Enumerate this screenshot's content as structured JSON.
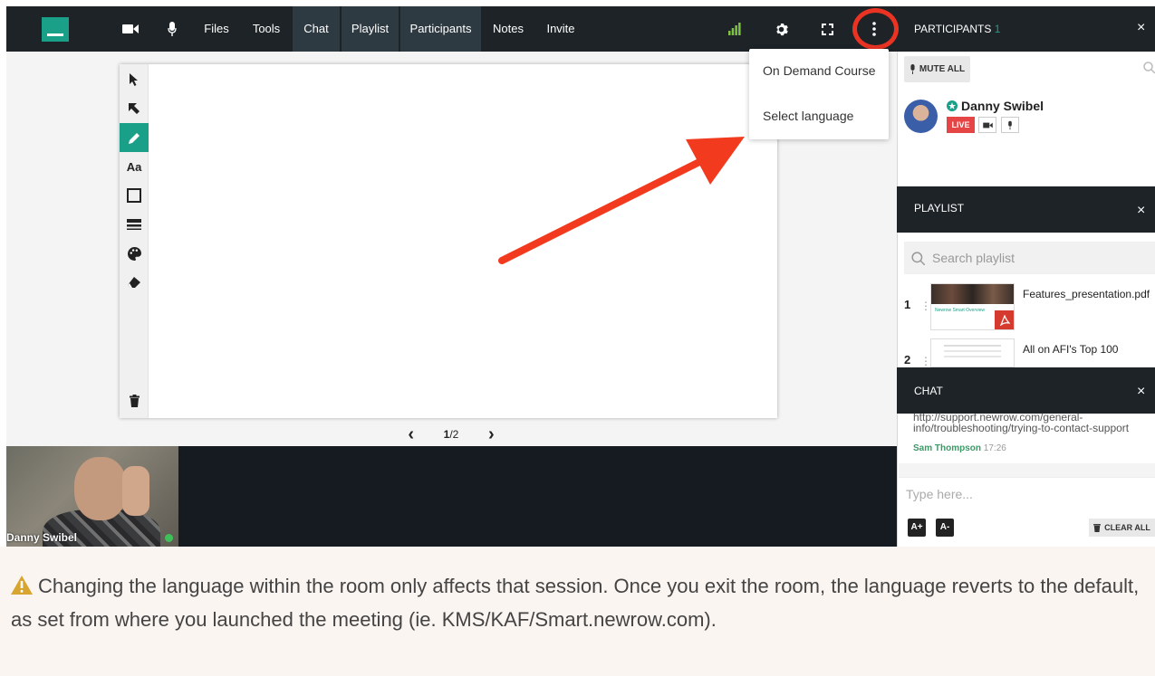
{
  "topbar": {
    "items": [
      "Files",
      "Tools",
      "Chat",
      "Playlist",
      "Participants",
      "Notes",
      "Invite"
    ],
    "icons": [
      "video-camera-icon",
      "microphone-icon",
      "signal-icon",
      "gear-icon",
      "fullscreen-icon",
      "more-vertical-icon"
    ]
  },
  "dropdown": {
    "items": [
      "On Demand Course",
      "Select language"
    ]
  },
  "whiteboard": {
    "tools": [
      "select-arrow-icon",
      "pointer-icon",
      "pencil-icon",
      "text-tool-icon",
      "rectangle-icon",
      "line-width-icon",
      "palette-icon",
      "eraser-icon",
      "trash-icon"
    ],
    "text_tool_label": "Aa",
    "page_current": "1",
    "page_sep": "/",
    "page_total": "2",
    "prev": "‹",
    "next": "›"
  },
  "camera": {
    "name": "Danny Swibel"
  },
  "participants": {
    "title": "PARTICIPANTS",
    "count": "1",
    "mute_all": "MUTE ALL",
    "person": {
      "name": "Danny Swibel",
      "status": "LIVE"
    }
  },
  "playlist": {
    "title": "PLAYLIST",
    "search_placeholder": "Search playlist",
    "items": [
      {
        "num": "1",
        "name": "Features_presentation.pdf",
        "thumb_text": "Newrow Smart Overview"
      },
      {
        "num": "2",
        "name": "All on AFI's Top 100"
      }
    ]
  },
  "chat": {
    "title": "CHAT",
    "message": "http://support.newrow.com/general-info/troubleshooting/trying-to-contact-support",
    "author": "Sam Thompson",
    "time": "17:26",
    "input_placeholder": "Type here...",
    "font_up": "A+",
    "font_down": "A-",
    "clear_all": "CLEAR ALL"
  },
  "close_glyph": "×",
  "note": {
    "text": "Changing the language within the room only affects that session. Once you exit the room, the language reverts to the default, as set from where you launched the meeting (ie. KMS/KAF/Smart.newrow.com)."
  },
  "colors": {
    "brand": "#1aa089",
    "topbar": "#1d2327",
    "highlight_red": "#ea3323",
    "live": "#e64545",
    "warning": "#d9a531"
  }
}
